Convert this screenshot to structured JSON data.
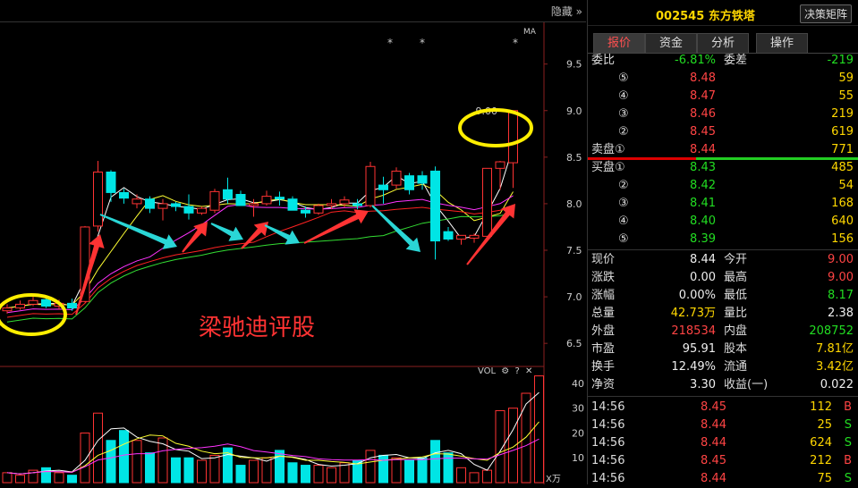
{
  "topbar": {
    "hide_label": "隐藏",
    "chevrons": "»"
  },
  "chart": {
    "ma_label": "MA",
    "price_ticks": [
      "9.5",
      "9.0",
      "8.5",
      "8.0",
      "7.5",
      "7.0",
      "6.5"
    ],
    "price_high_label": "9.00",
    "stars": [
      "*",
      "*",
      "*"
    ],
    "watermark": "梁驰迪评股",
    "vol_label": "VOL",
    "vol_ticks": [
      "40",
      "30",
      "20",
      "10"
    ],
    "vol_unit": "X万",
    "colors": {
      "up": "#ff3333",
      "down": "#00e5e5",
      "ma1": "#ffffff",
      "ma2": "#ffff33",
      "ma3": "#ff33ff",
      "ma4": "#33dd33",
      "ma5": "#ff2222",
      "arrow_up": "#ff3333",
      "arrow_down": "#2ad6d6",
      "circle": "#ffee00"
    }
  },
  "chart_data": {
    "type": "candlestick",
    "candles": [
      {
        "o": 6.85,
        "h": 6.92,
        "l": 6.82,
        "c": 6.88
      },
      {
        "o": 6.88,
        "h": 6.96,
        "l": 6.86,
        "c": 6.92
      },
      {
        "o": 6.92,
        "h": 7.0,
        "l": 6.9,
        "c": 6.96
      },
      {
        "o": 6.97,
        "h": 7.0,
        "l": 6.88,
        "c": 6.9
      },
      {
        "o": 6.9,
        "h": 6.97,
        "l": 6.86,
        "c": 6.93
      },
      {
        "o": 6.93,
        "h": 6.98,
        "l": 6.85,
        "c": 6.88
      },
      {
        "o": 6.95,
        "h": 7.76,
        "l": 6.94,
        "c": 7.75
      },
      {
        "o": 7.76,
        "h": 8.46,
        "l": 7.7,
        "c": 8.34
      },
      {
        "o": 8.34,
        "h": 8.36,
        "l": 8.02,
        "c": 8.12
      },
      {
        "o": 8.12,
        "h": 8.16,
        "l": 8.0,
        "c": 8.06
      },
      {
        "o": 8.0,
        "h": 8.1,
        "l": 7.95,
        "c": 8.05
      },
      {
        "o": 8.05,
        "h": 8.08,
        "l": 7.9,
        "c": 7.95
      },
      {
        "o": 7.95,
        "h": 8.05,
        "l": 7.82,
        "c": 8.0
      },
      {
        "o": 8.0,
        "h": 8.02,
        "l": 7.92,
        "c": 7.97
      },
      {
        "o": 7.97,
        "h": 8.1,
        "l": 7.83,
        "c": 7.9
      },
      {
        "o": 7.9,
        "h": 7.97,
        "l": 7.88,
        "c": 7.95
      },
      {
        "o": 7.93,
        "h": 8.16,
        "l": 7.9,
        "c": 8.13
      },
      {
        "o": 8.15,
        "h": 8.28,
        "l": 8.0,
        "c": 8.05
      },
      {
        "o": 8.1,
        "h": 8.14,
        "l": 7.98,
        "c": 7.98
      },
      {
        "o": 7.98,
        "h": 8.05,
        "l": 7.86,
        "c": 8.0
      },
      {
        "o": 8.0,
        "h": 8.14,
        "l": 7.98,
        "c": 8.08
      },
      {
        "o": 8.07,
        "h": 8.13,
        "l": 7.98,
        "c": 8.05
      },
      {
        "o": 8.05,
        "h": 8.08,
        "l": 7.93,
        "c": 7.93
      },
      {
        "o": 7.93,
        "h": 7.97,
        "l": 7.85,
        "c": 7.9
      },
      {
        "o": 7.9,
        "h": 8.0,
        "l": 7.88,
        "c": 7.98
      },
      {
        "o": 7.98,
        "h": 8.05,
        "l": 7.94,
        "c": 8.0
      },
      {
        "o": 8.0,
        "h": 8.08,
        "l": 7.96,
        "c": 8.04
      },
      {
        "o": 8.0,
        "h": 8.05,
        "l": 7.94,
        "c": 7.98
      },
      {
        "o": 7.98,
        "h": 8.45,
        "l": 7.96,
        "c": 8.4
      },
      {
        "o": 8.2,
        "h": 8.29,
        "l": 8.0,
        "c": 8.15
      },
      {
        "o": 8.2,
        "h": 8.39,
        "l": 8.16,
        "c": 8.35
      },
      {
        "o": 8.3,
        "h": 8.33,
        "l": 8.1,
        "c": 8.15
      },
      {
        "o": 8.3,
        "h": 8.35,
        "l": 8.15,
        "c": 8.22
      },
      {
        "o": 8.35,
        "h": 8.4,
        "l": 7.4,
        "c": 7.6
      },
      {
        "o": 7.7,
        "h": 7.75,
        "l": 7.6,
        "c": 7.62
      },
      {
        "o": 7.62,
        "h": 7.66,
        "l": 7.56,
        "c": 7.66
      },
      {
        "o": 7.63,
        "h": 7.68,
        "l": 7.58,
        "c": 7.66
      },
      {
        "o": 7.65,
        "h": 8.38,
        "l": 7.6,
        "c": 8.38
      },
      {
        "o": 8.38,
        "h": 8.46,
        "l": 8.15,
        "c": 8.45
      },
      {
        "o": 8.44,
        "h": 9.0,
        "l": 8.17,
        "c": 9.0
      }
    ],
    "volumes": [
      4,
      3,
      5,
      6,
      4,
      3,
      20,
      28,
      17,
      21,
      17,
      12,
      18,
      10,
      10,
      9,
      11,
      14,
      7,
      9,
      10,
      13,
      8,
      7,
      7,
      6,
      8,
      9,
      13,
      11,
      10,
      9,
      10,
      17,
      12,
      6,
      4,
      5,
      29,
      30,
      36,
      43
    ],
    "ylim": [
      6.3,
      9.9
    ],
    "vol_ylim": [
      0,
      45
    ]
  },
  "panel": {
    "code": "002545",
    "name": "东方铁塔",
    "matrix_btn": "决策矩阵",
    "tabs": [
      "报价",
      "资金",
      "分析",
      "操作"
    ],
    "weibi_label": "委比",
    "weibi_value": "-6.81%",
    "weicha_label": "委差",
    "weicha_value": "-219",
    "asks": [
      {
        "level": "⑤",
        "price": "8.48",
        "vol": "59"
      },
      {
        "level": "④",
        "price": "8.47",
        "vol": "55"
      },
      {
        "level": "③",
        "price": "8.46",
        "vol": "219"
      },
      {
        "level": "②",
        "price": "8.45",
        "vol": "619"
      },
      {
        "level": "卖盘①",
        "price": "8.44",
        "vol": "771"
      }
    ],
    "bids": [
      {
        "level": "买盘①",
        "price": "8.43",
        "vol": "485"
      },
      {
        "level": "②",
        "price": "8.42",
        "vol": "54"
      },
      {
        "level": "③",
        "price": "8.41",
        "vol": "168"
      },
      {
        "level": "④",
        "price": "8.40",
        "vol": "640"
      },
      {
        "level": "⑤",
        "price": "8.39",
        "vol": "156"
      }
    ],
    "stats": [
      {
        "l1": "现价",
        "v1": "8.44",
        "l2": "今开",
        "v2": "9.00"
      },
      {
        "l1": "涨跌",
        "v1": "0.00",
        "l2": "最高",
        "v2": "9.00"
      },
      {
        "l1": "涨幅",
        "v1": "0.00%",
        "l2": "最低",
        "v2": "8.17"
      },
      {
        "l1": "总量",
        "v1": "42.73万",
        "l2": "量比",
        "v2": "2.38"
      },
      {
        "l1": "外盘",
        "v1": "218534",
        "l2": "内盘",
        "v2": "208752"
      },
      {
        "l1": "市盈",
        "v1": "95.91",
        "l2": "股本",
        "v2": "7.81亿"
      },
      {
        "l1": "换手",
        "v1": "12.49%",
        "l2": "流通",
        "v2": "3.42亿"
      },
      {
        "l1": "净资",
        "v1": "3.30",
        "l2": "收益(一)",
        "v2": "0.022"
      }
    ],
    "ticks": [
      {
        "t": "14:56",
        "p": "8.45",
        "v": "112",
        "bs": "B"
      },
      {
        "t": "14:56",
        "p": "8.44",
        "v": "25",
        "bs": "S"
      },
      {
        "t": "14:56",
        "p": "8.44",
        "v": "624",
        "bs": "S"
      },
      {
        "t": "14:56",
        "p": "8.45",
        "v": "212",
        "bs": "B"
      },
      {
        "t": "14:56",
        "p": "8.44",
        "v": "75",
        "bs": "S"
      }
    ]
  }
}
